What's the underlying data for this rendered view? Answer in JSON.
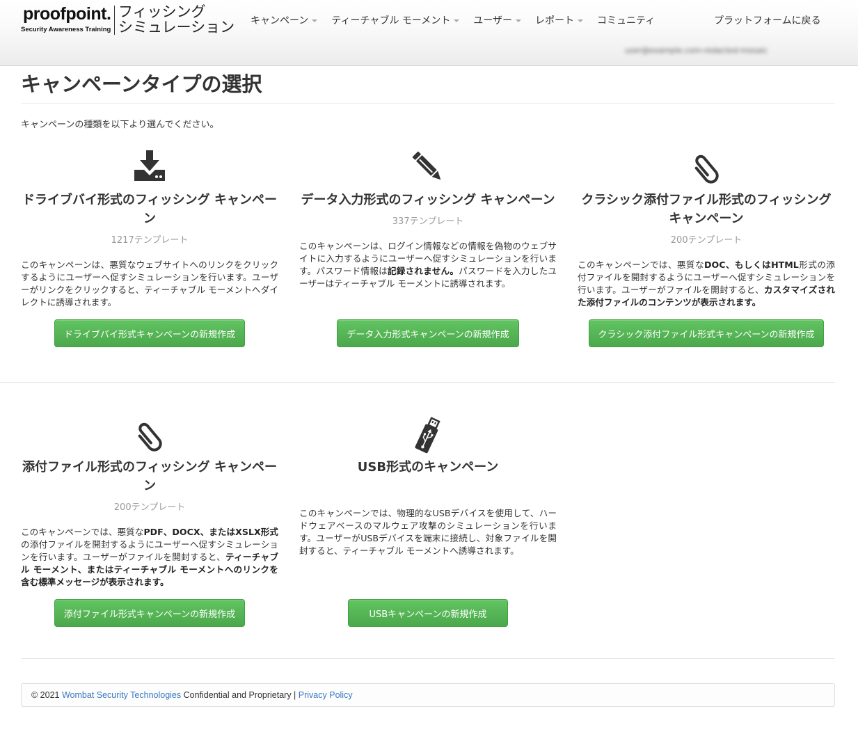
{
  "header": {
    "logo_word": "proofpoint.",
    "logo_sub": "Security Awareness Training",
    "app_title_line1": "フィッシング",
    "app_title_line2": "シミュレーション",
    "nav": [
      {
        "label": "キャンペーン"
      },
      {
        "label": "ティーチャブル モーメント"
      },
      {
        "label": "ユーザー"
      },
      {
        "label": "レポート"
      },
      {
        "label": "コミュニティ"
      }
    ],
    "back_label": "プラットフォームに戻る",
    "user_email": "user@example.com-redacted-mosaic"
  },
  "page": {
    "title": "キャンペーンタイプの選択",
    "intro": "キャンペーンの種類を以下より選んでください。"
  },
  "cards": [
    {
      "icon": "download-icon",
      "title": "ドライブバイ形式のフィッシング キャンペーン",
      "count": "1217テンプレート",
      "desc": "このキャンペーンは、悪質なウェブサイトへのリンクをクリックするようにユーザーへ促すシミュレーションを行います。ユーザーがリンクをクリックすると、ティーチャブル モーメントへダイレクトに誘導されます。",
      "button": "ドライブバイ形式キャンペーンの新規作成"
    },
    {
      "icon": "pencil-icon",
      "title": "データ入力形式のフィッシング キャンペーン",
      "count": "337テンプレート",
      "desc_a": "このキャンペーンは、ログイン情報などの情報を偽物のウェブサイトに入力するようにユーザーへ促すシミュレーションを行います。パスワード情報は",
      "desc_b": "記録されません。",
      "desc_c": "パスワードを入力したユーザーはティーチャブル モーメントに誘導されます。",
      "button": "データ入力形式キャンペーンの新規作成"
    },
    {
      "icon": "paperclip-icon",
      "title": "クラシック添付ファイル形式のフィッシング キャンペーン",
      "count": "200テンプレート",
      "desc_a": "このキャンペーンでは、悪質な",
      "desc_b": "DOC、もしくはHTML",
      "desc_c": "形式の添付ファイルを開封するようにユーザーへ促すシミュレーションを行います。ユーザーがファイルを開封すると、",
      "desc_d": "カスタマイズされた添付ファイルのコンテンツが表示されます。",
      "button": "クラシック添付ファイル形式キャンペーンの新規作成"
    },
    {
      "icon": "paperclip-icon",
      "title": "添付ファイル形式のフィッシング キャンペーン",
      "count": "200テンプレート",
      "desc_a": "このキャンペーンでは、悪質な",
      "desc_b": "PDF、DOCX、またはXSLX形式",
      "desc_c": "の添付ファイルを開封するようにユーザーへ促すシミュレーションを行います。ユーザーがファイルを開封すると、",
      "desc_d": "ティーチャブル モーメント、またはティーチャブル モーメントへのリンクを含む標準メッセージが表示されます。",
      "button": "添付ファイル形式キャンペーンの新規作成"
    },
    {
      "icon": "usb-icon",
      "title": "USB形式のキャンペーン",
      "desc": "このキャンペーンでは、物理的なUSBデバイスを使用して、ハードウェアベースのマルウェア攻撃のシミュレーションを行います。ユーザーがUSBデバイスを端末に接続し、対象ファイルを開封すると、ティーチャブル モーメントへ誘導されます。",
      "button": "USBキャンペーンの新規作成"
    }
  ],
  "footer": {
    "copyright": "© 2021",
    "company_link": "Wombat Security Technologies",
    "confidential": "Confidential and Proprietary |",
    "privacy_link": "Privacy Policy"
  },
  "colors": {
    "button_green": "#5cb85c",
    "link_blue": "#3a78c2",
    "muted_gray": "#999999"
  }
}
